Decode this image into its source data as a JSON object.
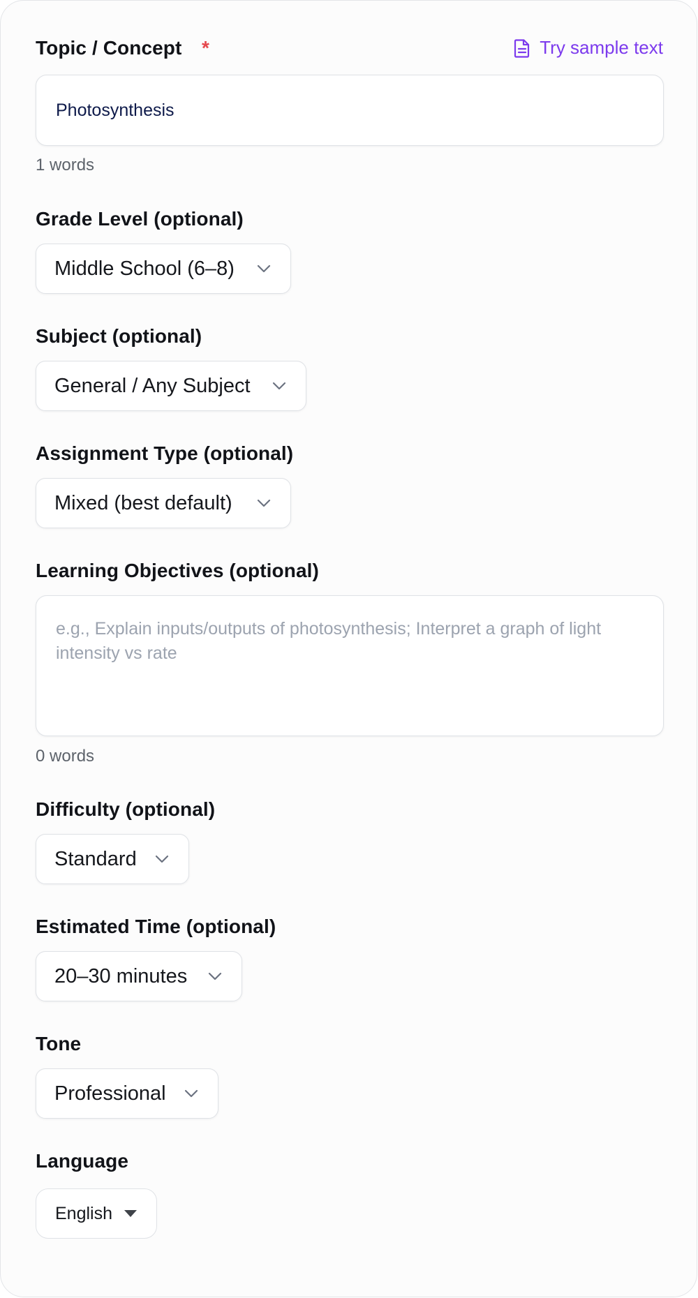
{
  "topic": {
    "label": "Topic / Concept",
    "required_marker": "*",
    "sample_link": "Try sample text",
    "value": "Photosynthesis",
    "word_count": "1 words"
  },
  "grade_level": {
    "label": "Grade Level (optional)",
    "selected": "Middle School (6–8)"
  },
  "subject": {
    "label": "Subject (optional)",
    "selected": "General / Any Subject"
  },
  "assignment_type": {
    "label": "Assignment Type (optional)",
    "selected": "Mixed (best default)"
  },
  "learning_objectives": {
    "label": "Learning Objectives (optional)",
    "placeholder": "e.g., Explain inputs/outputs of photosynthesis; Interpret a graph of light intensity vs rate",
    "word_count": "0 words"
  },
  "difficulty": {
    "label": "Difficulty (optional)",
    "selected": "Standard"
  },
  "estimated_time": {
    "label": "Estimated Time (optional)",
    "selected": "20–30 minutes"
  },
  "tone": {
    "label": "Tone",
    "selected": "Professional"
  },
  "language": {
    "label": "Language",
    "selected": "English"
  },
  "colors": {
    "accent": "#7c3aed",
    "required": "#e5484d",
    "placeholder": "#9ca3af",
    "input_text": "#0e1a4a"
  },
  "icons": {
    "sample_link": "document-icon",
    "select": "chevron-down-icon",
    "language_select": "caret-down-icon"
  }
}
